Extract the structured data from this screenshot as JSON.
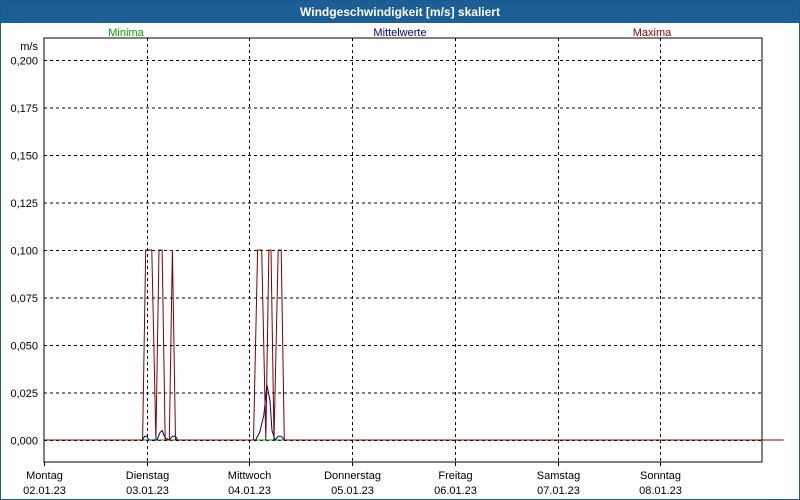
{
  "window": {
    "title": "Windgeschwindigkeit [m/s] skaliert"
  },
  "colors": {
    "minima": "#00a000",
    "mittelwerte": "#000080",
    "maxima": "#800000",
    "grid": "#000000"
  },
  "chart_data": {
    "type": "line",
    "ylabel": "m/s",
    "ylim": [
      0,
      0.2
    ],
    "yticks": [
      "0,200",
      "0,175",
      "0,150",
      "0,125",
      "0,100",
      "0,075",
      "0,050",
      "0,025",
      "0,000"
    ],
    "ytick_values": [
      0.2,
      0.175,
      0.15,
      0.125,
      0.1,
      0.075,
      0.05,
      0.025,
      0
    ],
    "xlim": [
      0,
      7.2
    ],
    "xticks": [
      {
        "day": "Montag",
        "date": "02.01.23",
        "x": 0
      },
      {
        "day": "Dienstag",
        "date": "03.01.23",
        "x": 1
      },
      {
        "day": "Mittwoch",
        "date": "04.01.23",
        "x": 2
      },
      {
        "day": "Donnerstag",
        "date": "05.01.23",
        "x": 3
      },
      {
        "day": "Freitag",
        "date": "06.01.23",
        "x": 4
      },
      {
        "day": "Samstag",
        "date": "07.01.23",
        "x": 5
      },
      {
        "day": "Sonntag",
        "date": "08.01.23",
        "x": 6
      }
    ],
    "legend": [
      "Minima",
      "Mittelwerte",
      "Maxima"
    ],
    "series": [
      {
        "name": "Minima",
        "color": "#00a000",
        "points": [
          [
            0,
            0
          ],
          [
            7.2,
            0
          ]
        ]
      },
      {
        "name": "Mittelwerte",
        "color": "#000080",
        "points": [
          [
            0,
            0
          ],
          [
            0.96,
            0
          ],
          [
            0.98,
            0.002
          ],
          [
            1.0,
            0.002
          ],
          [
            1.02,
            0
          ],
          [
            1.1,
            0
          ],
          [
            1.13,
            0.004
          ],
          [
            1.15,
            0.005
          ],
          [
            1.18,
            0.001
          ],
          [
            1.22,
            0
          ],
          [
            1.25,
            0.002
          ],
          [
            1.28,
            0.002
          ],
          [
            1.3,
            0
          ],
          [
            2.06,
            0
          ],
          [
            2.1,
            0.004
          ],
          [
            2.14,
            0.013
          ],
          [
            2.17,
            0.029
          ],
          [
            2.2,
            0.021
          ],
          [
            2.22,
            0.005
          ],
          [
            2.25,
            0
          ],
          [
            2.28,
            0.002
          ],
          [
            2.31,
            0.002
          ],
          [
            2.34,
            0
          ],
          [
            7.2,
            0
          ]
        ]
      },
      {
        "name": "Maxima",
        "color": "#800000",
        "points": [
          [
            0,
            0
          ],
          [
            0.96,
            0
          ],
          [
            0.99,
            0.1
          ],
          [
            1.02,
            0.1
          ],
          [
            1.05,
            0.1
          ],
          [
            1.09,
            0
          ],
          [
            1.12,
            0.1
          ],
          [
            1.15,
            0.1
          ],
          [
            1.18,
            0
          ],
          [
            1.22,
            0
          ],
          [
            1.25,
            0.1
          ],
          [
            1.28,
            0
          ],
          [
            2.04,
            0
          ],
          [
            2.08,
            0.1
          ],
          [
            2.12,
            0.1
          ],
          [
            2.16,
            0
          ],
          [
            2.19,
            0.1
          ],
          [
            2.21,
            0.1
          ],
          [
            2.24,
            0
          ],
          [
            2.28,
            0.1
          ],
          [
            2.31,
            0.1
          ],
          [
            2.34,
            0
          ],
          [
            7.2,
            0
          ]
        ]
      }
    ]
  }
}
